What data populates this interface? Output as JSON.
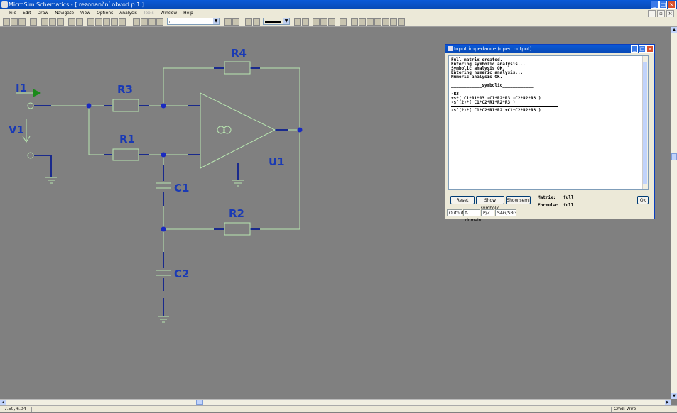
{
  "window": {
    "title": "MicroSim Schematics - [ rezonanční obvod  p.1 ]"
  },
  "menu": [
    "File",
    "Edit",
    "Draw",
    "Navigate",
    "View",
    "Options",
    "Analysis",
    "Tools",
    "Window",
    "Help"
  ],
  "toolbar": {
    "part_combo_value": "r"
  },
  "schematic": {
    "labels": {
      "i1": "I1",
      "v1": "V1",
      "r1": "R1",
      "r2": "R2",
      "r3": "R3",
      "r4": "R4",
      "c1": "C1",
      "c2": "C2",
      "u1": "U1",
      "opamp_symbol": "OO"
    }
  },
  "dialog": {
    "title": "Input impedance (open output)",
    "output_lines": [
      "Full matrix created.",
      "Entering symbolic analysis...",
      "Symbolic analysis OK.",
      "Entering numeric analysis...",
      "Numeric analysis OK."
    ],
    "symbolic_header": "____________symbolic____________",
    "result_lines": [
      "-R3",
      "+s*( C1*R1*R3 -C1*R2*R3 -C2*R2*R3 )",
      "-s^(2)*( C1*C2*R1*R2*R3 )"
    ],
    "denominator_line": "-s^(2)*( C1*C2*R1*R2 +C1*C2*R2*R3 )",
    "buttons": {
      "reset": "Reset",
      "show_symbolic": "Show symbolic",
      "show_semi": "Show semi",
      "ok": "Ok"
    },
    "matrix_label": "Matrix:",
    "matrix_value": "full",
    "formula_label": "Formula:",
    "formula_value": "full",
    "tabs": [
      "Output",
      "f-domain",
      "P/Z",
      "SAG/SBG"
    ]
  },
  "status": {
    "coordinates": "7.50, 6.04",
    "command": "Cmd: Wire"
  }
}
